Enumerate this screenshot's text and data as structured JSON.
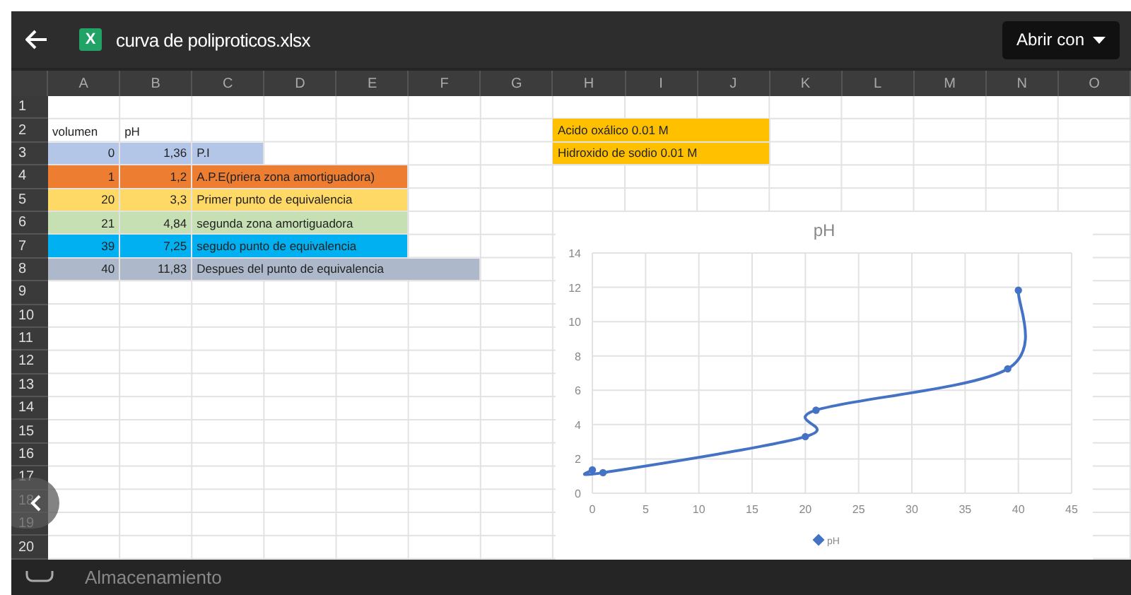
{
  "topbar": {
    "file_name": "curva de poliproticos.xlsx",
    "file_badge": "X",
    "open_with": "Abrir con"
  },
  "columns": [
    "A",
    "B",
    "C",
    "D",
    "E",
    "F",
    "G",
    "H",
    "I",
    "J",
    "K",
    "L",
    "M",
    "N",
    "O"
  ],
  "row_numbers": [
    "1",
    "2",
    "3",
    "4",
    "5",
    "6",
    "7",
    "8",
    "9",
    "10",
    "11",
    "12",
    "13",
    "14",
    "15",
    "16",
    "17",
    "18",
    "19",
    "20"
  ],
  "table": {
    "headers": [
      "volumen",
      "pH"
    ],
    "rows": [
      {
        "volume": "0",
        "ph": "1,36",
        "description": "P.I",
        "color": "#b4c6e7"
      },
      {
        "volume": "1",
        "ph": "1,2",
        "description": "A.P.E(priera zona amortiguadora)",
        "color": "#ed7d31"
      },
      {
        "volume": "20",
        "ph": "3,3",
        "description": "Primer punto de equivalencia",
        "color": "#ffd966"
      },
      {
        "volume": "21",
        "ph": "4,84",
        "description": "segunda zona amortiguadora",
        "color": "#c6e0b4"
      },
      {
        "volume": "39",
        "ph": "7,25",
        "description": "segudo punto de equivalencia",
        "color": "#00b0f0"
      },
      {
        "volume": "40",
        "ph": "11,83",
        "description": "Despues del punto de equivalencia",
        "color": "#adb9ca"
      }
    ]
  },
  "note": {
    "color": "#ffc000",
    "lines": [
      "Acido oxálico 0.01 M",
      "Hidroxido de sodio 0.01 M"
    ]
  },
  "chart": {
    "chart_data": {
      "type": "line",
      "grid": true,
      "title": "pH",
      "x": [
        0,
        1,
        20,
        21,
        39,
        40
      ],
      "series": [
        {
          "name": "pH",
          "color": "#4472c4",
          "marker": "circle",
          "values": [
            1.36,
            1.2,
            3.3,
            4.84,
            7.25,
            11.83
          ]
        }
      ],
      "xlim": [
        0,
        45
      ],
      "ylim": [
        0,
        14
      ],
      "xticks": [
        {
          "value": 0,
          "label": "0"
        },
        {
          "value": 5,
          "label": "5"
        },
        {
          "value": 10,
          "label": "10"
        },
        {
          "value": 15,
          "label": "15"
        },
        {
          "value": 20,
          "label": "20"
        },
        {
          "value": 25,
          "label": "25"
        },
        {
          "value": 30,
          "label": "30"
        },
        {
          "value": 35,
          "label": "35"
        },
        {
          "value": 40,
          "label": "40"
        },
        {
          "value": 45,
          "label": "45"
        }
      ],
      "yticks": [
        {
          "value": 0,
          "label": "0"
        },
        {
          "value": 2,
          "label": "2"
        },
        {
          "value": 4,
          "label": "4"
        },
        {
          "value": 6,
          "label": "6"
        },
        {
          "value": 8,
          "label": "8"
        },
        {
          "value": 10,
          "label": "10"
        },
        {
          "value": 12,
          "label": "12"
        },
        {
          "value": 14,
          "label": "14"
        }
      ]
    }
  },
  "bottom_strip": {
    "label": "Almacenamiento"
  }
}
